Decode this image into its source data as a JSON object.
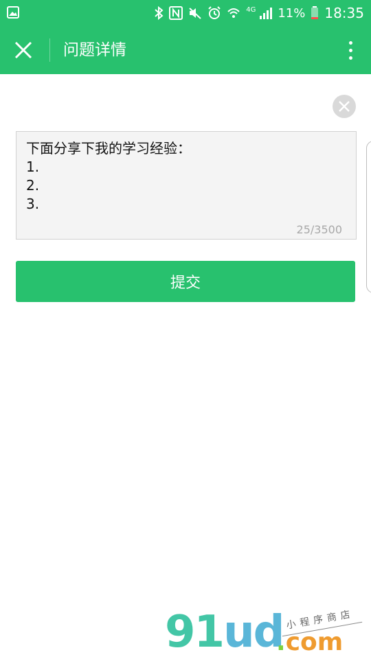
{
  "status_bar": {
    "network": "4G",
    "battery": "11%",
    "time": "18:35"
  },
  "titlebar": {
    "title": "问题详情",
    "close_icon": "close-icon",
    "more_icon": "more-vertical-icon"
  },
  "editor": {
    "lines": [
      "下面分享下我的学习经验：",
      "1.",
      "2.",
      "3."
    ],
    "counter": "25/3500",
    "clear_icon": "clear-circle-icon"
  },
  "submit": {
    "label": "提交"
  },
  "watermark": {
    "logo": "91ud",
    "logo_part1": "91",
    "logo_part2": "ud",
    "dot": ".",
    "com": "com",
    "subtitle": "小程序商店"
  },
  "colors": {
    "brand_green": "#28c16e",
    "input_bg": "#f4f4f4",
    "counter_gray": "#a8a8a8"
  }
}
